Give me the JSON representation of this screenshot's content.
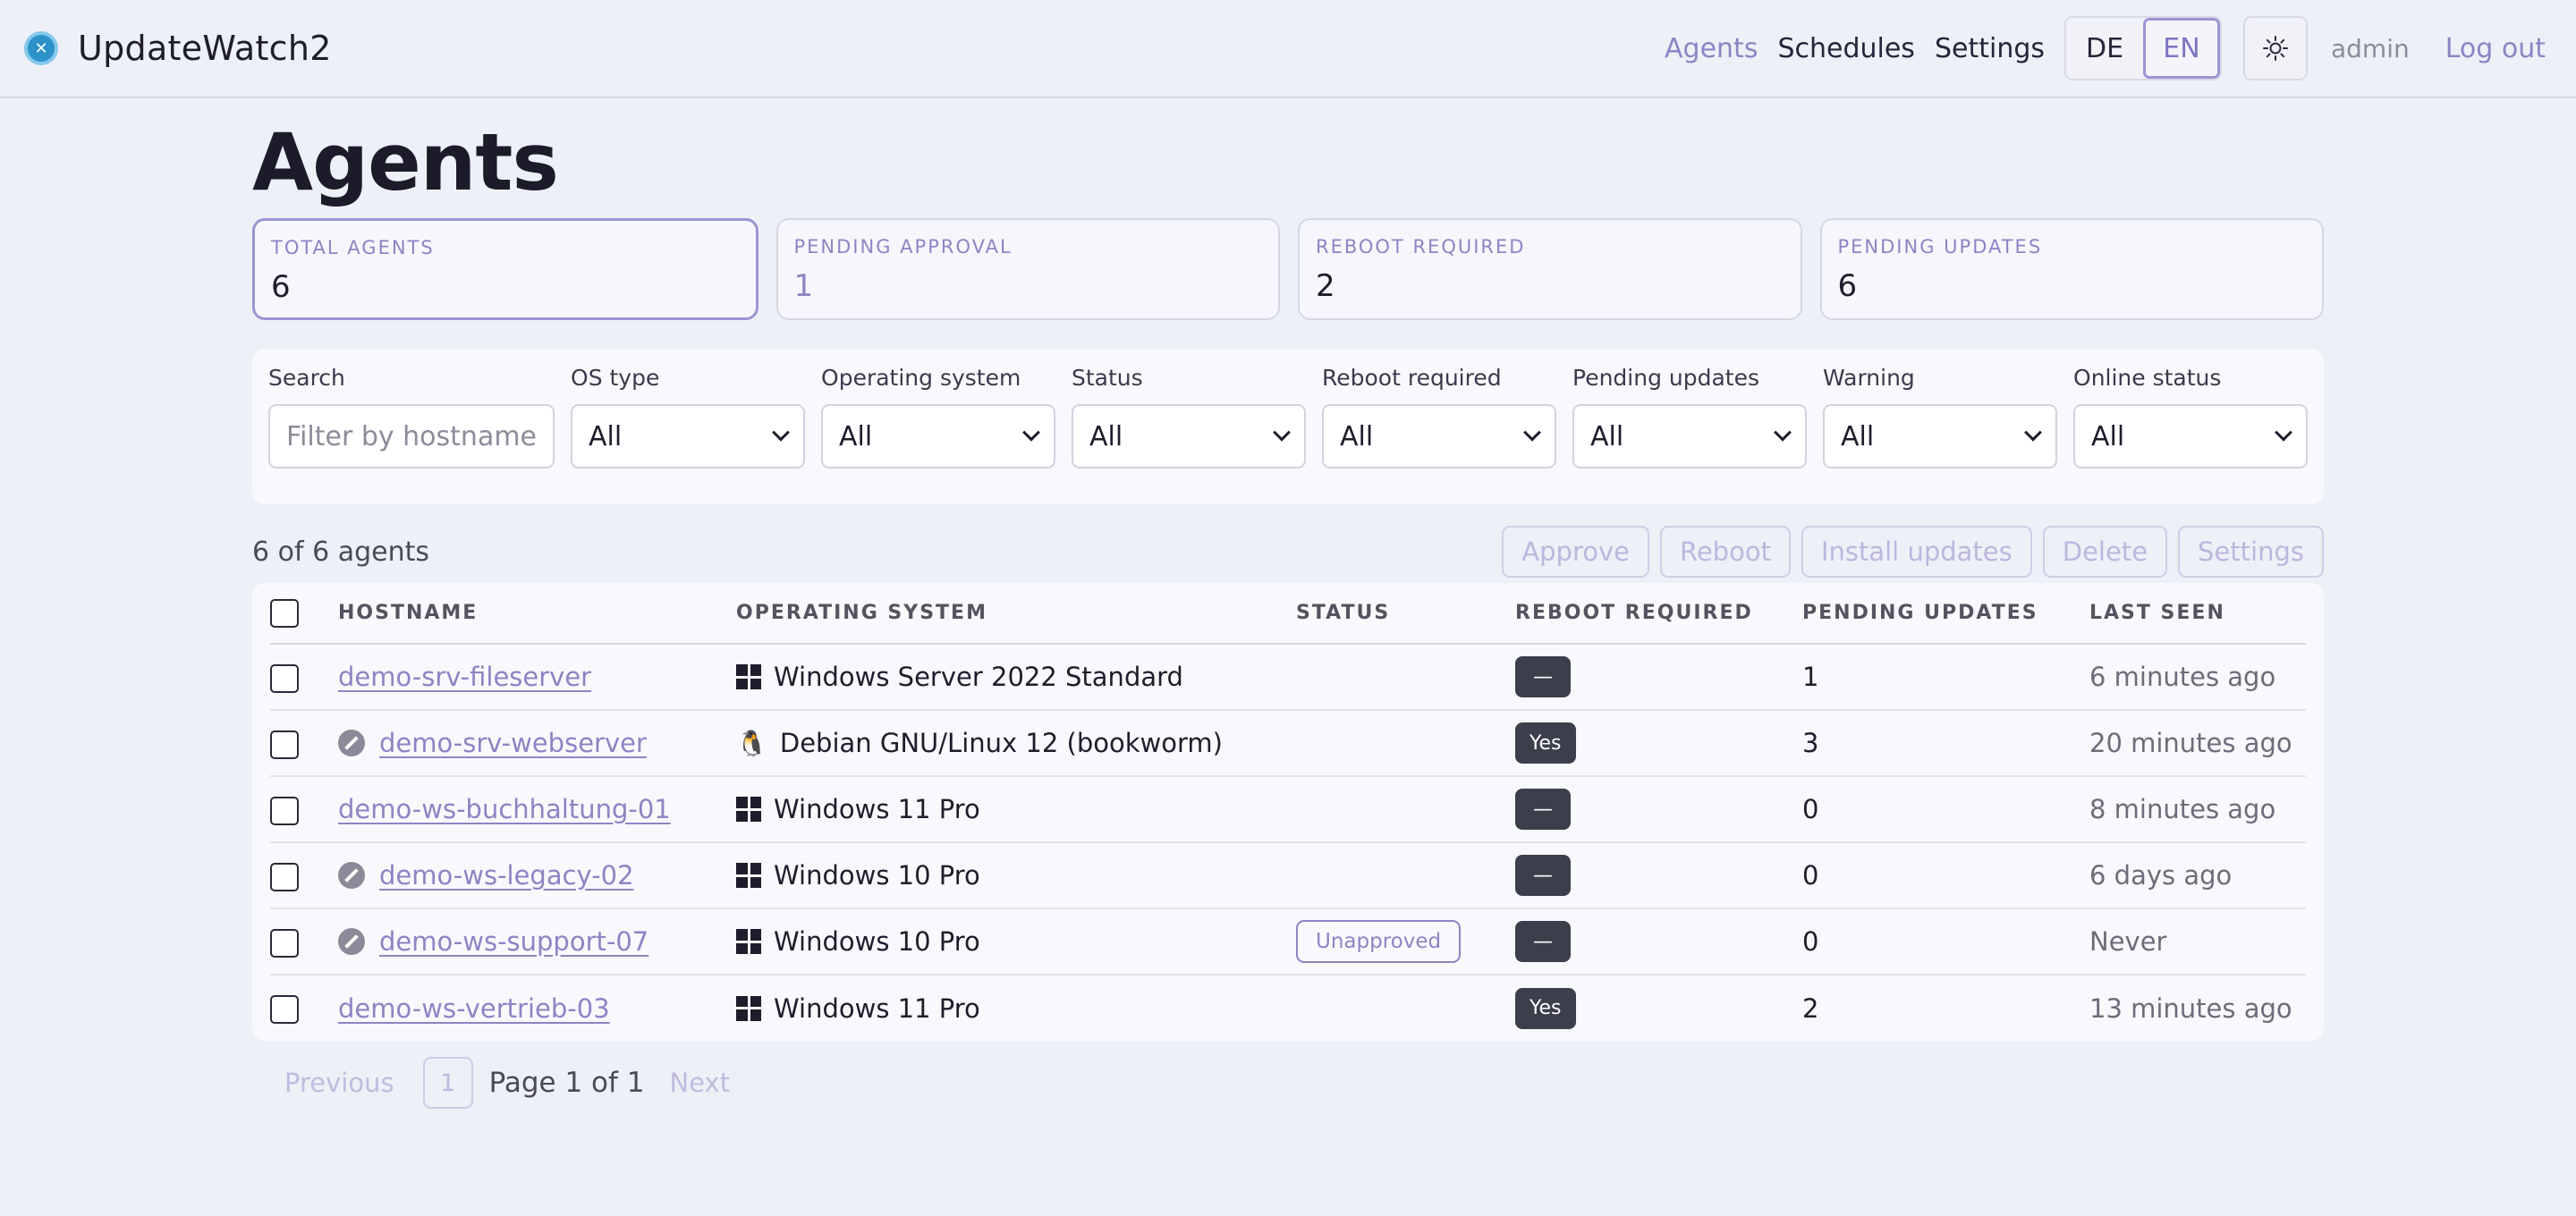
{
  "app": {
    "name": "UpdateWatch2"
  },
  "nav": {
    "links": [
      "Agents",
      "Schedules",
      "Settings"
    ],
    "languages": [
      "DE",
      "EN"
    ],
    "user": "admin",
    "logout": "Log out"
  },
  "page": {
    "title": "Agents"
  },
  "stats": [
    {
      "label": "TOTAL AGENTS",
      "value": "6"
    },
    {
      "label": "PENDING APPROVAL",
      "value": "1"
    },
    {
      "label": "REBOOT REQUIRED",
      "value": "2"
    },
    {
      "label": "PENDING UPDATES",
      "value": "6"
    }
  ],
  "filters": {
    "search": {
      "label": "Search",
      "placeholder": "Filter by hostname"
    },
    "selects": [
      {
        "label": "OS type",
        "value": "All"
      },
      {
        "label": "Operating system",
        "value": "All"
      },
      {
        "label": "Status",
        "value": "All"
      },
      {
        "label": "Reboot required",
        "value": "All"
      },
      {
        "label": "Pending updates",
        "value": "All"
      },
      {
        "label": "Warning",
        "value": "All"
      },
      {
        "label": "Online status",
        "value": "All"
      }
    ]
  },
  "toolbar": {
    "count": "6 of 6 agents",
    "actions": [
      "Approve",
      "Reboot",
      "Install updates",
      "Delete",
      "Settings"
    ]
  },
  "table": {
    "columns": [
      "HOSTNAME",
      "OPERATING SYSTEM",
      "STATUS",
      "REBOOT REQUIRED",
      "PENDING UPDATES",
      "LAST SEEN"
    ],
    "rows": [
      {
        "hostname": "demo-srv-fileserver",
        "offline": false,
        "os_icon": "windows-icon",
        "os": "Windows Server 2022 Standard",
        "status": "",
        "reboot": "—",
        "pending": "1",
        "last_seen": "6 minutes ago"
      },
      {
        "hostname": "demo-srv-webserver",
        "offline": true,
        "os_icon": "linux-icon",
        "os": "Debian GNU/Linux 12 (bookworm)",
        "status": "",
        "reboot": "Yes",
        "pending": "3",
        "last_seen": "20 minutes ago"
      },
      {
        "hostname": "demo-ws-buchhaltung-01",
        "offline": false,
        "os_icon": "windows-icon",
        "os": "Windows 11 Pro",
        "status": "",
        "reboot": "—",
        "pending": "0",
        "last_seen": "8 minutes ago"
      },
      {
        "hostname": "demo-ws-legacy-02",
        "offline": true,
        "os_icon": "windows-icon",
        "os": "Windows 10 Pro",
        "status": "",
        "reboot": "—",
        "pending": "0",
        "last_seen": "6 days ago"
      },
      {
        "hostname": "demo-ws-support-07",
        "offline": true,
        "os_icon": "windows-icon",
        "os": "Windows 10 Pro",
        "status": "Unapproved",
        "reboot": "—",
        "pending": "0",
        "last_seen": "Never"
      },
      {
        "hostname": "demo-ws-vertrieb-03",
        "offline": false,
        "os_icon": "windows-icon",
        "os": "Windows 11 Pro",
        "status": "",
        "reboot": "Yes",
        "pending": "2",
        "last_seen": "13 minutes ago"
      }
    ]
  },
  "pagination": {
    "previous": "Previous",
    "current": "1",
    "text": "Page 1 of 1",
    "next": "Next"
  },
  "colors": {
    "accent": "#8d84c4",
    "background": "#eef0f8",
    "badge": "#3c3e4c"
  }
}
